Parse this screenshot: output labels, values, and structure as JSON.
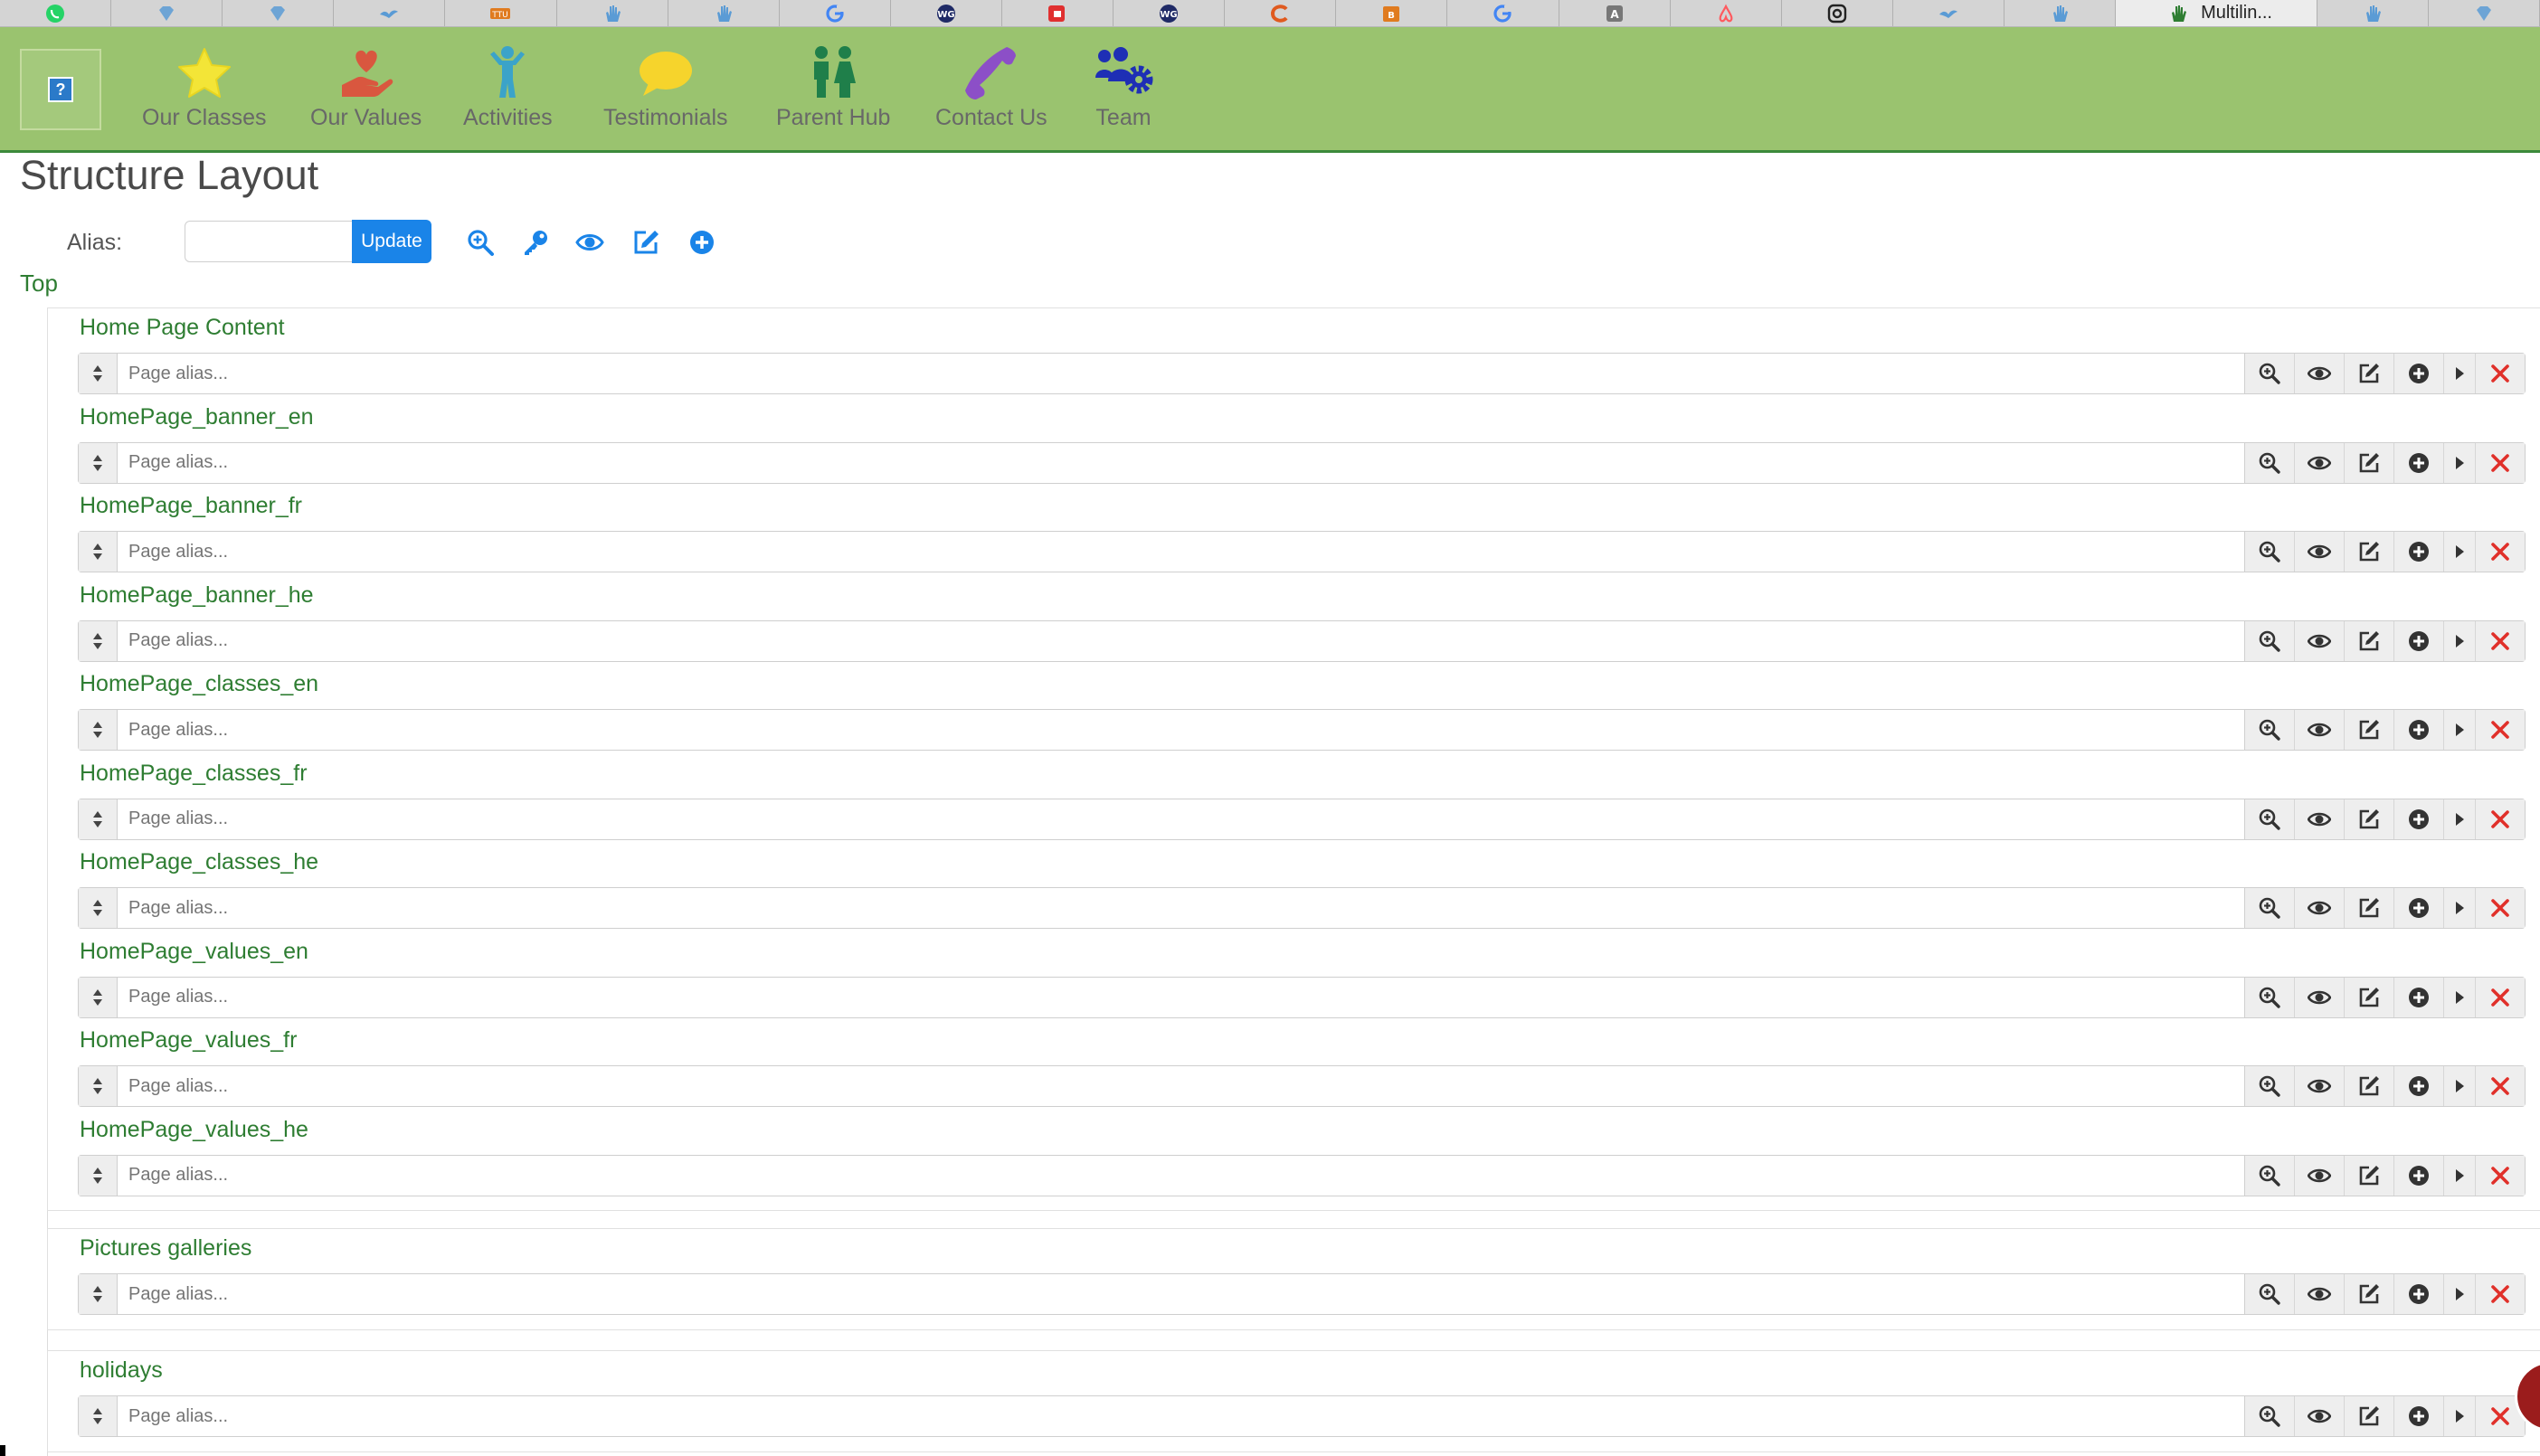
{
  "browser": {
    "tabs": [
      {
        "icon": "whatsapp-icon",
        "color": "#25d366"
      },
      {
        "icon": "gem-icon",
        "color": "#5a9bd5"
      },
      {
        "icon": "gem-icon",
        "color": "#5a9bd5"
      },
      {
        "icon": "bird-icon",
        "color": "#5a9bd5"
      },
      {
        "icon": "ttu-icon",
        "color": "#e07b1f"
      },
      {
        "icon": "hand-icon",
        "color": "#5a9bd5"
      },
      {
        "icon": "hand-icon",
        "color": "#5a9bd5"
      },
      {
        "icon": "google-icon",
        "color": "#4285f4"
      },
      {
        "icon": "wg-icon",
        "color": "#1f2a66"
      },
      {
        "icon": "red-square-icon",
        "color": "#e03030"
      },
      {
        "icon": "wg-icon",
        "color": "#1f2a66"
      },
      {
        "icon": "c-icon",
        "color": "#e05a1f"
      },
      {
        "icon": "bi-icon",
        "color": "#e07b1f"
      },
      {
        "icon": "google-icon",
        "color": "#4285f4"
      },
      {
        "icon": "a-icon",
        "color": "#777777"
      },
      {
        "icon": "airbnb-icon",
        "color": "#ff5a5f"
      },
      {
        "icon": "instagram-icon",
        "color": "#222222"
      },
      {
        "icon": "bird-icon",
        "color": "#5a9bd5"
      },
      {
        "icon": "hand-icon",
        "color": "#5a9bd5"
      }
    ],
    "active_tab": {
      "title": "Multilin...",
      "icon": "hand-icon",
      "color": "#2e7d32"
    },
    "trailing_tabs": [
      {
        "icon": "hand-icon",
        "color": "#5a9bd5"
      },
      {
        "icon": "gem-icon",
        "color": "#5a9bd5"
      }
    ]
  },
  "header": {
    "help_icon_label": "?",
    "nav": [
      {
        "id": "our-classes",
        "label": "Our Classes",
        "icon": "star-icon",
        "color": "#f3e537"
      },
      {
        "id": "our-values",
        "label": "Our Values",
        "icon": "heart-hand-icon",
        "color": "#d9573f"
      },
      {
        "id": "activities",
        "label": "Activities",
        "icon": "child-icon",
        "color": "#3ba3c9"
      },
      {
        "id": "testimonials",
        "label": "Testimonials",
        "icon": "speech-bubble-icon",
        "color": "#f6d42c"
      },
      {
        "id": "parent-hub",
        "label": "Parent Hub",
        "icon": "parents-icon",
        "color": "#1f7f4a"
      },
      {
        "id": "contact-us",
        "label": "Contact Us",
        "icon": "phone-icon",
        "color": "#8c4fc7"
      },
      {
        "id": "team",
        "label": "Team",
        "icon": "team-gear-icon",
        "color": "#1e2fb5"
      }
    ]
  },
  "page": {
    "title": "Structure Layout",
    "alias_label": "Alias:",
    "alias_value": "",
    "update_label": "Update",
    "top_link": "Top",
    "accent": "#1a84e8",
    "delete_color": "#e0302a"
  },
  "groups": [
    {
      "entries": [
        {
          "title": "Home Page Content",
          "placeholder": "Page alias..."
        },
        {
          "title": "HomePage_banner_en",
          "placeholder": "Page alias..."
        },
        {
          "title": "HomePage_banner_fr",
          "placeholder": "Page alias..."
        },
        {
          "title": "HomePage_banner_he",
          "placeholder": "Page alias..."
        },
        {
          "title": "HomePage_classes_en",
          "placeholder": "Page alias..."
        },
        {
          "title": "HomePage_classes_fr",
          "placeholder": "Page alias..."
        },
        {
          "title": "HomePage_classes_he",
          "placeholder": "Page alias..."
        },
        {
          "title": "HomePage_values_en",
          "placeholder": "Page alias..."
        },
        {
          "title": "HomePage_values_fr",
          "placeholder": "Page alias..."
        },
        {
          "title": "HomePage_values_he",
          "placeholder": "Page alias..."
        }
      ]
    },
    {
      "entries": [
        {
          "title": "Pictures galleries",
          "placeholder": "Page alias..."
        }
      ]
    },
    {
      "entries": [
        {
          "title": "holidays",
          "placeholder": "Page alias..."
        }
      ]
    }
  ]
}
